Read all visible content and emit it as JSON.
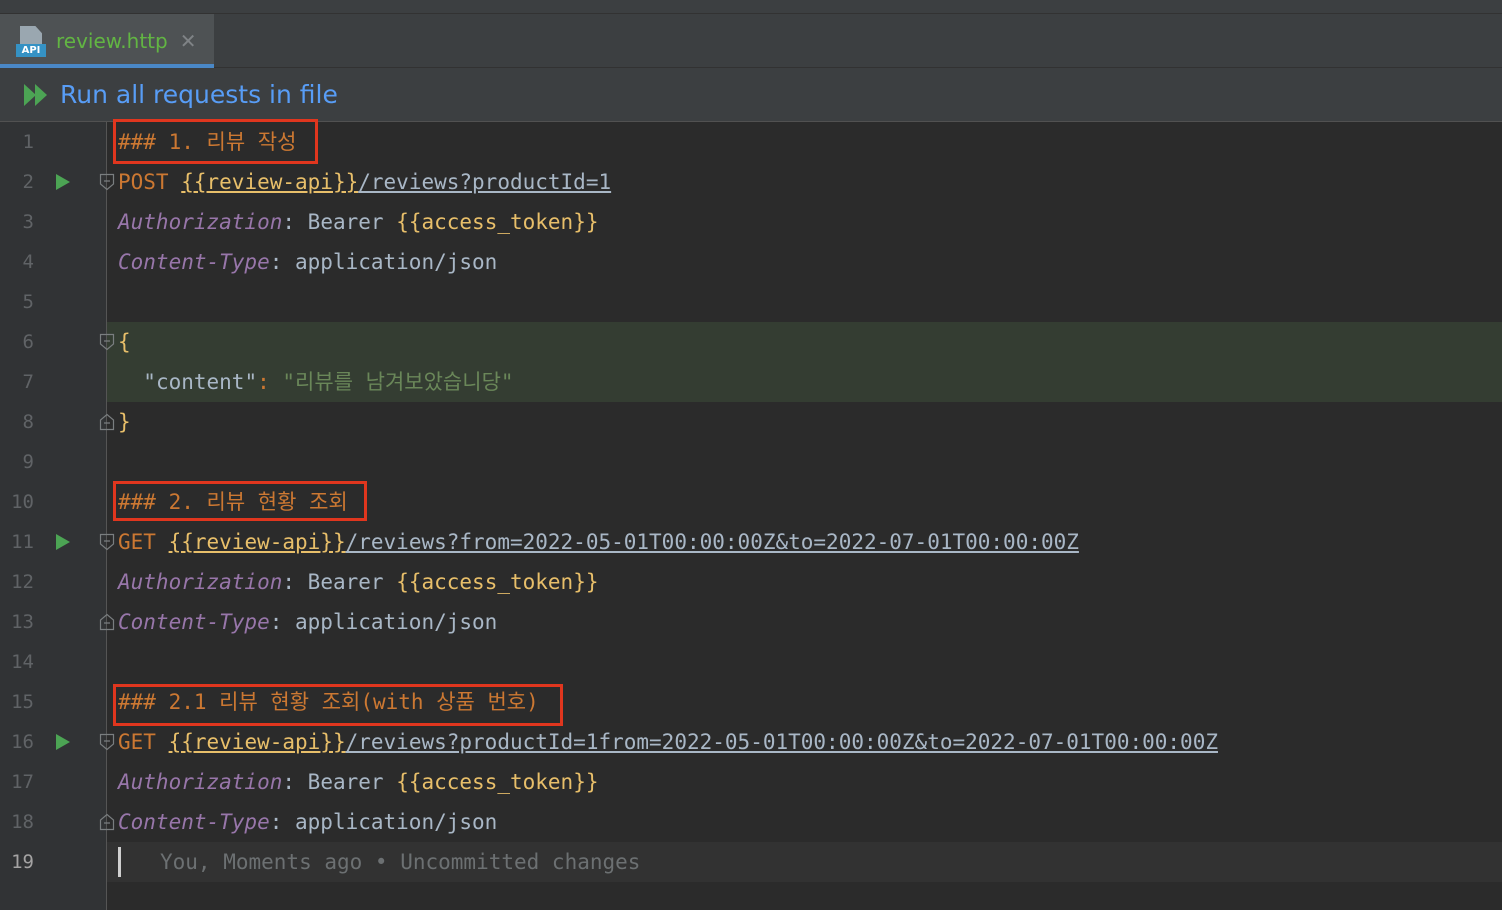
{
  "tab": {
    "icon_badge": "API",
    "filename": "review.http",
    "close_glyph": "✕"
  },
  "runbar": {
    "label": "Run all requests in file"
  },
  "lines": [
    {
      "num": "1",
      "comment": "### 1. 리뷰 작성"
    },
    {
      "num": "2",
      "method": "POST",
      "var": "{{review-api}}",
      "path": "/reviews?productId=1"
    },
    {
      "num": "3",
      "header": "Authorization",
      "sep": ":",
      "prefix": " Bearer ",
      "var": "{{access_token}}"
    },
    {
      "num": "4",
      "header": "Content-Type",
      "sep": ":",
      "value": " application/json"
    },
    {
      "num": "5"
    },
    {
      "num": "6",
      "brace": "{"
    },
    {
      "num": "7",
      "key": "\"content\"",
      "sep": ":",
      "str": "\"리뷰를 남겨보았습니당\""
    },
    {
      "num": "8",
      "brace": "}"
    },
    {
      "num": "9"
    },
    {
      "num": "10",
      "comment": "### 2. 리뷰 현황 조회"
    },
    {
      "num": "11",
      "method": "GET",
      "var": "{{review-api}}",
      "path": "/reviews?from=2022-05-01T00:00:00Z&to=2022-07-01T00:00:00Z"
    },
    {
      "num": "12",
      "header": "Authorization",
      "sep": ":",
      "prefix": " Bearer ",
      "var": "{{access_token}}"
    },
    {
      "num": "13",
      "header": "Content-Type",
      "sep": ":",
      "value": " application/json"
    },
    {
      "num": "14"
    },
    {
      "num": "15",
      "comment": "### 2.1 리뷰 현황 조회(with 상품 번호)"
    },
    {
      "num": "16",
      "method": "GET",
      "var": "{{review-api}}",
      "path": "/reviews?productId=1from=2022-05-01T00:00:00Z&to=2022-07-01T00:00:00Z"
    },
    {
      "num": "17",
      "header": "Authorization",
      "sep": ":",
      "prefix": " Bearer ",
      "var": "{{access_token}}"
    },
    {
      "num": "18",
      "header": "Content-Type",
      "sep": ":",
      "value": " application/json"
    },
    {
      "num": "19",
      "blame": "You, Moments ago • Uncommitted changes"
    }
  ],
  "colors": {
    "accent": "#4a88c7",
    "highlight_box": "#e0361e",
    "run_green": "#4ca454"
  }
}
